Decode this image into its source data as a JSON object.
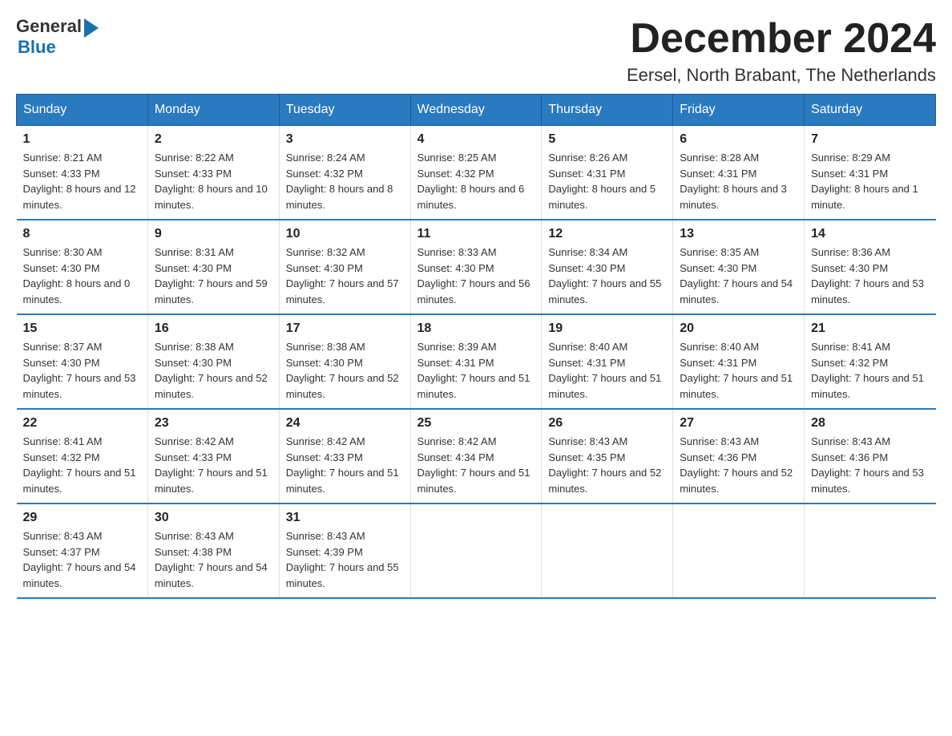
{
  "header": {
    "logo": {
      "general": "General",
      "blue": "Blue"
    },
    "title": "December 2024",
    "location": "Eersel, North Brabant, The Netherlands"
  },
  "days_of_week": [
    "Sunday",
    "Monday",
    "Tuesday",
    "Wednesday",
    "Thursday",
    "Friday",
    "Saturday"
  ],
  "weeks": [
    [
      {
        "day": "1",
        "sunrise": "Sunrise: 8:21 AM",
        "sunset": "Sunset: 4:33 PM",
        "daylight": "Daylight: 8 hours and 12 minutes."
      },
      {
        "day": "2",
        "sunrise": "Sunrise: 8:22 AM",
        "sunset": "Sunset: 4:33 PM",
        "daylight": "Daylight: 8 hours and 10 minutes."
      },
      {
        "day": "3",
        "sunrise": "Sunrise: 8:24 AM",
        "sunset": "Sunset: 4:32 PM",
        "daylight": "Daylight: 8 hours and 8 minutes."
      },
      {
        "day": "4",
        "sunrise": "Sunrise: 8:25 AM",
        "sunset": "Sunset: 4:32 PM",
        "daylight": "Daylight: 8 hours and 6 minutes."
      },
      {
        "day": "5",
        "sunrise": "Sunrise: 8:26 AM",
        "sunset": "Sunset: 4:31 PM",
        "daylight": "Daylight: 8 hours and 5 minutes."
      },
      {
        "day": "6",
        "sunrise": "Sunrise: 8:28 AM",
        "sunset": "Sunset: 4:31 PM",
        "daylight": "Daylight: 8 hours and 3 minutes."
      },
      {
        "day": "7",
        "sunrise": "Sunrise: 8:29 AM",
        "sunset": "Sunset: 4:31 PM",
        "daylight": "Daylight: 8 hours and 1 minute."
      }
    ],
    [
      {
        "day": "8",
        "sunrise": "Sunrise: 8:30 AM",
        "sunset": "Sunset: 4:30 PM",
        "daylight": "Daylight: 8 hours and 0 minutes."
      },
      {
        "day": "9",
        "sunrise": "Sunrise: 8:31 AM",
        "sunset": "Sunset: 4:30 PM",
        "daylight": "Daylight: 7 hours and 59 minutes."
      },
      {
        "day": "10",
        "sunrise": "Sunrise: 8:32 AM",
        "sunset": "Sunset: 4:30 PM",
        "daylight": "Daylight: 7 hours and 57 minutes."
      },
      {
        "day": "11",
        "sunrise": "Sunrise: 8:33 AM",
        "sunset": "Sunset: 4:30 PM",
        "daylight": "Daylight: 7 hours and 56 minutes."
      },
      {
        "day": "12",
        "sunrise": "Sunrise: 8:34 AM",
        "sunset": "Sunset: 4:30 PM",
        "daylight": "Daylight: 7 hours and 55 minutes."
      },
      {
        "day": "13",
        "sunrise": "Sunrise: 8:35 AM",
        "sunset": "Sunset: 4:30 PM",
        "daylight": "Daylight: 7 hours and 54 minutes."
      },
      {
        "day": "14",
        "sunrise": "Sunrise: 8:36 AM",
        "sunset": "Sunset: 4:30 PM",
        "daylight": "Daylight: 7 hours and 53 minutes."
      }
    ],
    [
      {
        "day": "15",
        "sunrise": "Sunrise: 8:37 AM",
        "sunset": "Sunset: 4:30 PM",
        "daylight": "Daylight: 7 hours and 53 minutes."
      },
      {
        "day": "16",
        "sunrise": "Sunrise: 8:38 AM",
        "sunset": "Sunset: 4:30 PM",
        "daylight": "Daylight: 7 hours and 52 minutes."
      },
      {
        "day": "17",
        "sunrise": "Sunrise: 8:38 AM",
        "sunset": "Sunset: 4:30 PM",
        "daylight": "Daylight: 7 hours and 52 minutes."
      },
      {
        "day": "18",
        "sunrise": "Sunrise: 8:39 AM",
        "sunset": "Sunset: 4:31 PM",
        "daylight": "Daylight: 7 hours and 51 minutes."
      },
      {
        "day": "19",
        "sunrise": "Sunrise: 8:40 AM",
        "sunset": "Sunset: 4:31 PM",
        "daylight": "Daylight: 7 hours and 51 minutes."
      },
      {
        "day": "20",
        "sunrise": "Sunrise: 8:40 AM",
        "sunset": "Sunset: 4:31 PM",
        "daylight": "Daylight: 7 hours and 51 minutes."
      },
      {
        "day": "21",
        "sunrise": "Sunrise: 8:41 AM",
        "sunset": "Sunset: 4:32 PM",
        "daylight": "Daylight: 7 hours and 51 minutes."
      }
    ],
    [
      {
        "day": "22",
        "sunrise": "Sunrise: 8:41 AM",
        "sunset": "Sunset: 4:32 PM",
        "daylight": "Daylight: 7 hours and 51 minutes."
      },
      {
        "day": "23",
        "sunrise": "Sunrise: 8:42 AM",
        "sunset": "Sunset: 4:33 PM",
        "daylight": "Daylight: 7 hours and 51 minutes."
      },
      {
        "day": "24",
        "sunrise": "Sunrise: 8:42 AM",
        "sunset": "Sunset: 4:33 PM",
        "daylight": "Daylight: 7 hours and 51 minutes."
      },
      {
        "day": "25",
        "sunrise": "Sunrise: 8:42 AM",
        "sunset": "Sunset: 4:34 PM",
        "daylight": "Daylight: 7 hours and 51 minutes."
      },
      {
        "day": "26",
        "sunrise": "Sunrise: 8:43 AM",
        "sunset": "Sunset: 4:35 PM",
        "daylight": "Daylight: 7 hours and 52 minutes."
      },
      {
        "day": "27",
        "sunrise": "Sunrise: 8:43 AM",
        "sunset": "Sunset: 4:36 PM",
        "daylight": "Daylight: 7 hours and 52 minutes."
      },
      {
        "day": "28",
        "sunrise": "Sunrise: 8:43 AM",
        "sunset": "Sunset: 4:36 PM",
        "daylight": "Daylight: 7 hours and 53 minutes."
      }
    ],
    [
      {
        "day": "29",
        "sunrise": "Sunrise: 8:43 AM",
        "sunset": "Sunset: 4:37 PM",
        "daylight": "Daylight: 7 hours and 54 minutes."
      },
      {
        "day": "30",
        "sunrise": "Sunrise: 8:43 AM",
        "sunset": "Sunset: 4:38 PM",
        "daylight": "Daylight: 7 hours and 54 minutes."
      },
      {
        "day": "31",
        "sunrise": "Sunrise: 8:43 AM",
        "sunset": "Sunset: 4:39 PM",
        "daylight": "Daylight: 7 hours and 55 minutes."
      },
      null,
      null,
      null,
      null
    ]
  ]
}
